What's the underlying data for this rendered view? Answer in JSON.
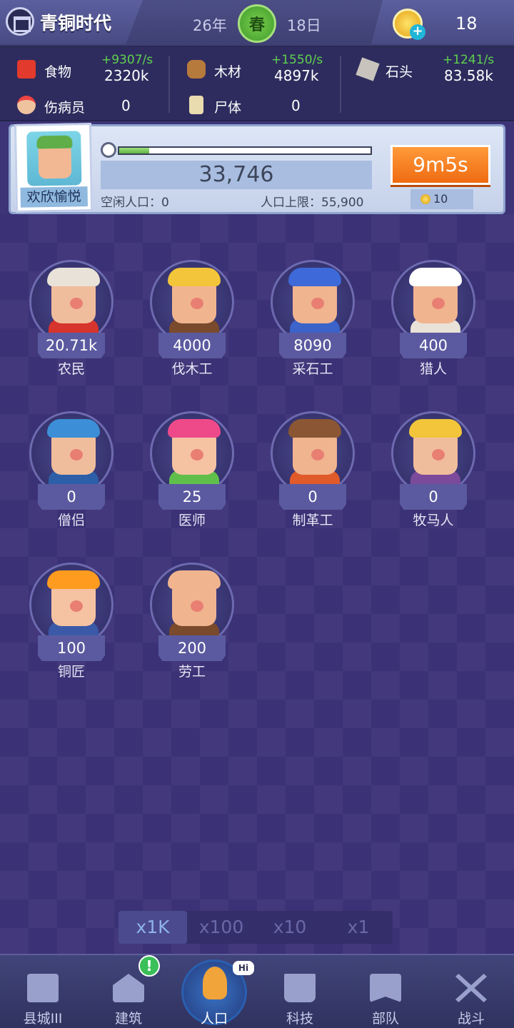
{
  "header": {
    "era_title": "青铜时代",
    "year": "26年",
    "season": "春",
    "day": "18日",
    "gem_count": "18"
  },
  "resources": [
    {
      "icon": "food-icon",
      "label": "食物",
      "rate": "+9307/s",
      "value": "2320k"
    },
    {
      "icon": "wood-icon",
      "label": "木材",
      "rate": "+1550/s",
      "value": "4897k"
    },
    {
      "icon": "stone-icon",
      "label": "石头",
      "rate": "+1241/s",
      "value": "83.58k"
    },
    {
      "icon": "wounded-icon",
      "label": "伤病员",
      "value": "0"
    },
    {
      "icon": "corpse-icon",
      "label": "尸体",
      "value": "0"
    }
  ],
  "population": {
    "mood": "欢欣愉悦",
    "count": "33,746",
    "idle_label": "空闲人口：0",
    "limit_label": "人口上限：55,900",
    "progress": 0.12,
    "timer": "9m5s",
    "cost": "10"
  },
  "workers": [
    {
      "name": "农民",
      "count": "20.71k"
    },
    {
      "name": "伐木工",
      "count": "4000"
    },
    {
      "name": "采石工",
      "count": "8090"
    },
    {
      "name": "猎人",
      "count": "400"
    },
    {
      "name": "僧侣",
      "count": "0"
    },
    {
      "name": "医师",
      "count": "25"
    },
    {
      "name": "制革工",
      "count": "0"
    },
    {
      "name": "牧马人",
      "count": "0"
    },
    {
      "name": "铜匠",
      "count": "100"
    },
    {
      "name": "劳工",
      "count": "200"
    }
  ],
  "multipliers": [
    "x1K",
    "x100",
    "x10",
    "x1"
  ],
  "active_multiplier": "x1K",
  "nav": [
    {
      "label": "县城III",
      "icon": "castle-icon"
    },
    {
      "label": "建筑",
      "icon": "house-icon"
    },
    {
      "label": "人口",
      "icon": "person-icon"
    },
    {
      "label": "科技",
      "icon": "book-icon"
    },
    {
      "label": "部队",
      "icon": "banner-icon"
    },
    {
      "label": "战斗",
      "icon": "crossed-swords-icon"
    }
  ],
  "badges": {
    "build": "!",
    "population": "Hi"
  },
  "colors": {
    "rate_green": "#5fd24e",
    "timer_orange": "#ef6b12",
    "accent_blue": "#8fb2ec"
  }
}
